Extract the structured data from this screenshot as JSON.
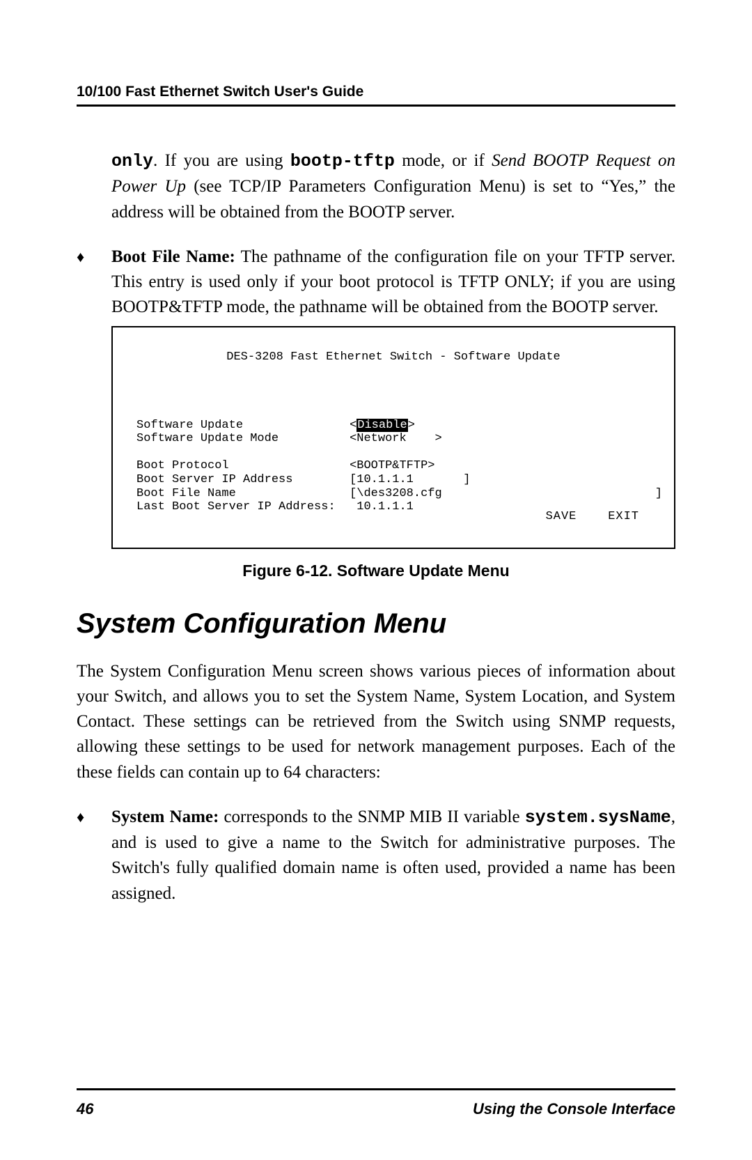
{
  "header": {
    "running_head": "10/100 Fast Ethernet Switch User's Guide"
  },
  "p1": {
    "only": "only",
    "t1": ".  If you are using ",
    "mode": "bootp-tftp",
    "t2": " mode, or if ",
    "em": "Send BOOTP Request on Power Up",
    "t3": "  (see TCP/IP Parameters Configuration Menu) is set to “Yes,” the address will be obtained from the BOOTP server."
  },
  "p2": {
    "label": "Boot File Name:",
    "body": "  The pathname of the configuration file on your TFTP server. This entry is used only if your boot protocol is TFTP ONLY; if you are using BOOTP&TFTP mode, the pathname will be obtained from the BOOTP server."
  },
  "figbox": {
    "title": "DES-3208 Fast Ethernet Switch - Software Update",
    "rows": [
      {
        "label": "Software Update",
        "value_pre": "<",
        "value_hl": "Disable",
        "value_post": ">"
      },
      {
        "label": "Software Update Mode",
        "value": "<Network    >"
      },
      {
        "label": "",
        "value": ""
      },
      {
        "label": "Boot Protocol",
        "value": "<BOOTP&TFTP>"
      },
      {
        "label": "Boot Server IP Address",
        "value": "[10.1.1.1       ]"
      },
      {
        "label": "Boot File Name",
        "value": "[\\des3208.cfg                              ]"
      },
      {
        "label": "Last Boot Server IP Address:",
        "value": " 10.1.1.1"
      }
    ],
    "save": "SAVE",
    "exit": "EXIT"
  },
  "figure_caption": "Figure 6-12. Software Update Menu",
  "section_heading": "System Configuration Menu",
  "p3": "The System Configuration Menu screen shows various pieces of information about your Switch, and allows you to set the System Name, System Location, and System Contact.  These settings can be retrieved from the Switch using SNMP requests, allowing these settings to be used for network management purposes.  Each of the these fields can contain up to 64 characters:",
  "p4": {
    "label": "System Name:",
    "t1": " corresponds to the SNMP MIB II variable ",
    "code": "system.sysName",
    "t2": ", and is used to give a name to the Switch for administrative purposes.  The Switch's fully qualified domain name is often used, provided a name has been assigned."
  },
  "footer": {
    "page_number": "46",
    "section": "Using the Console Interface"
  },
  "bullet_glyph": "♦"
}
